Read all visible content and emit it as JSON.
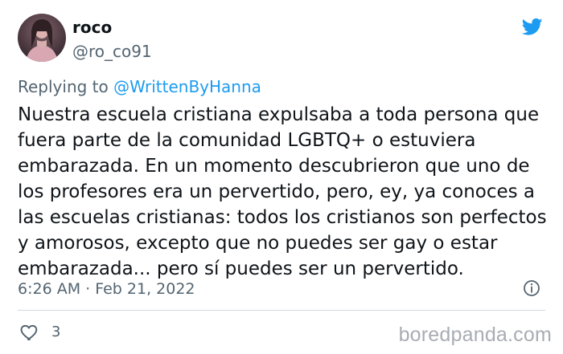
{
  "user": {
    "display_name": "roco",
    "handle": "@ro_co91"
  },
  "reply": {
    "prefix": "Replying to",
    "mention": "@WrittenByHanna"
  },
  "tweet": {
    "text": "Nuestra escuela cristiana expulsaba a toda persona que\nfuera parte de la comunidad LGBTQ+ o estuviera\nembarazada. En un momento descubrieron que uno de\nlos profesores era un pervertido, pero, ey, ya conoces a\nlas escuelas cristianas: todos los cristianos son perfectos\ny amorosos, excepto que no puedes ser gay o estar\nembarazada... pero sí puedes ser un pervertido.",
    "timestamp": "6:26 AM · Feb 21, 2022",
    "like_count": "3"
  },
  "watermark": {
    "text": "boredpanda.com"
  },
  "icons": {
    "brand": "twitter-bird-icon",
    "info": "info-icon",
    "like": "heart-icon"
  },
  "colors": {
    "brand_blue": "#1d9bf0",
    "secondary_text": "#536471",
    "primary_text": "#0f1419",
    "divider": "#cfd9de",
    "watermark": "#a8adb3"
  }
}
